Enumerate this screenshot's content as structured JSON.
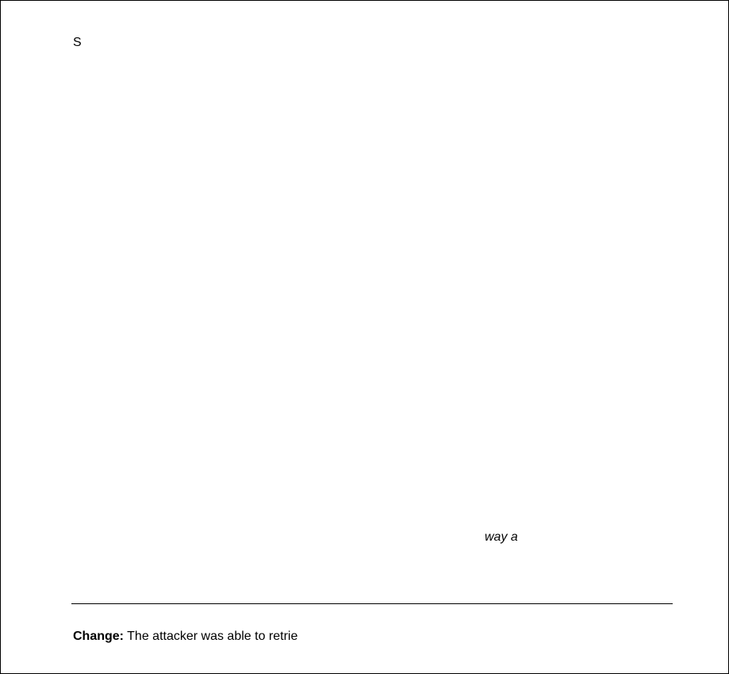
{
  "document": {
    "top_letter": "S",
    "italic_fragment": "way a",
    "footer": {
      "label": "Change:",
      "text": " The attacker was able to retrie"
    }
  }
}
